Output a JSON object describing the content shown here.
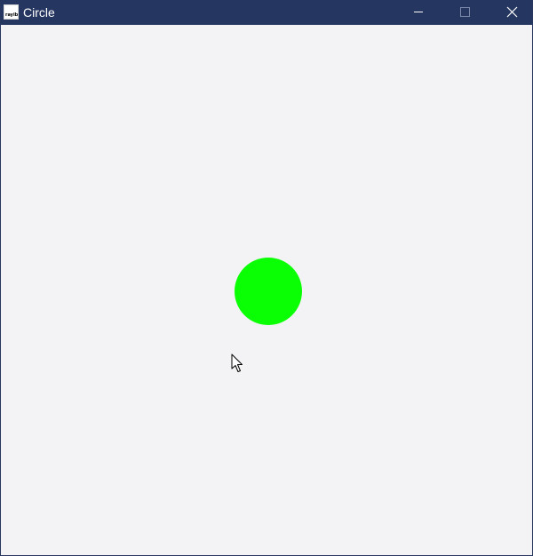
{
  "window": {
    "title": "Circle",
    "app_icon_label": "rayib"
  },
  "titlebar": {
    "buttons": [
      "minimize",
      "maximize",
      "close"
    ]
  },
  "canvas": {
    "background": "#f3f2f4",
    "shape": "circle",
    "circle_color": "#0aff05"
  },
  "colors": {
    "titlebar": "#253660",
    "title_text": "#ffffff"
  }
}
